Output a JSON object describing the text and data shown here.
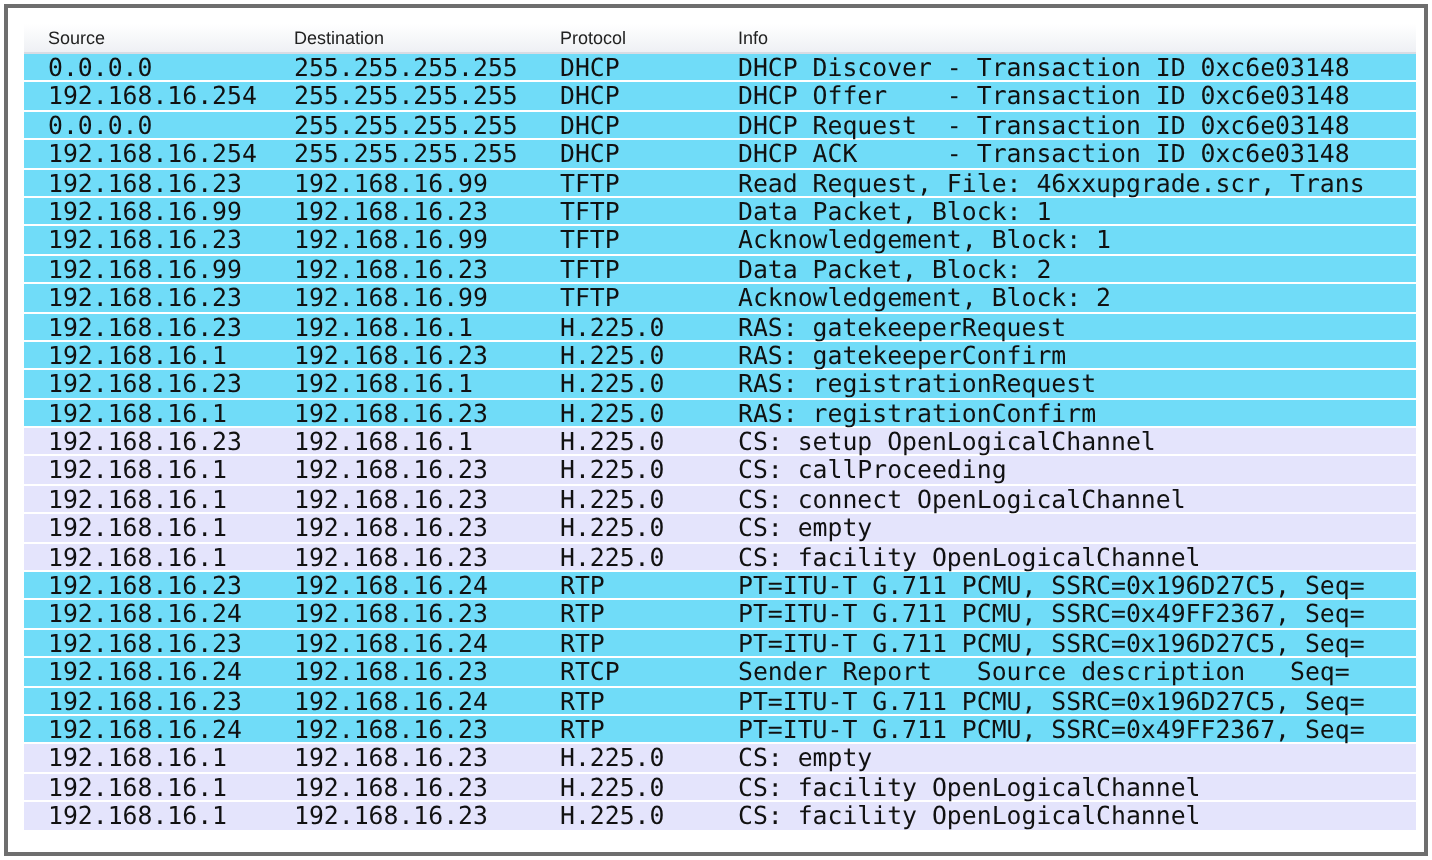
{
  "table": {
    "columns": [
      "Source",
      "Destination",
      "Protocol",
      "Info"
    ],
    "rows": [
      {
        "source": "0.0.0.0",
        "destination": "255.255.255.255",
        "protocol": "DHCP",
        "info": "DHCP Discover - Transaction ID 0xc6e03148",
        "color": "#70dcf8"
      },
      {
        "source": "192.168.16.254",
        "destination": "255.255.255.255",
        "protocol": "DHCP",
        "info": "DHCP Offer    - Transaction ID 0xc6e03148",
        "color": "#70dcf8"
      },
      {
        "source": "0.0.0.0",
        "destination": "255.255.255.255",
        "protocol": "DHCP",
        "info": "DHCP Request  - Transaction ID 0xc6e03148",
        "color": "#70dcf8"
      },
      {
        "source": "192.168.16.254",
        "destination": "255.255.255.255",
        "protocol": "DHCP",
        "info": "DHCP ACK      - Transaction ID 0xc6e03148",
        "color": "#70dcf8"
      },
      {
        "source": "192.168.16.23",
        "destination": "192.168.16.99",
        "protocol": "TFTP",
        "info": "Read Request, File: 46xxupgrade.scr, Trans",
        "color": "#70dcf8"
      },
      {
        "source": "192.168.16.99",
        "destination": "192.168.16.23",
        "protocol": "TFTP",
        "info": "Data Packet, Block: 1",
        "color": "#70dcf8"
      },
      {
        "source": "192.168.16.23",
        "destination": "192.168.16.99",
        "protocol": "TFTP",
        "info": "Acknowledgement, Block: 1",
        "color": "#70dcf8"
      },
      {
        "source": "192.168.16.99",
        "destination": "192.168.16.23",
        "protocol": "TFTP",
        "info": "Data Packet, Block: 2",
        "color": "#70dcf8"
      },
      {
        "source": "192.168.16.23",
        "destination": "192.168.16.99",
        "protocol": "TFTP",
        "info": "Acknowledgement, Block: 2",
        "color": "#70dcf8"
      },
      {
        "source": "192.168.16.23",
        "destination": "192.168.16.1",
        "protocol": "H.225.0",
        "info": "RAS: gatekeeperRequest",
        "color": "#70dcf8"
      },
      {
        "source": "192.168.16.1",
        "destination": "192.168.16.23",
        "protocol": "H.225.0",
        "info": "RAS: gatekeeperConfirm",
        "color": "#70dcf8"
      },
      {
        "source": "192.168.16.23",
        "destination": "192.168.16.1",
        "protocol": "H.225.0",
        "info": "RAS: registrationRequest",
        "color": "#70dcf8"
      },
      {
        "source": "192.168.16.1",
        "destination": "192.168.16.23",
        "protocol": "H.225.0",
        "info": "RAS: registrationConfirm",
        "color": "#70dcf8"
      },
      {
        "source": "192.168.16.23",
        "destination": "192.168.16.1",
        "protocol": "H.225.0",
        "info": "CS: setup OpenLogicalChannel",
        "color": "#e4e4fc"
      },
      {
        "source": "192.168.16.1",
        "destination": "192.168.16.23",
        "protocol": "H.225.0",
        "info": "CS: callProceeding",
        "color": "#e4e4fc"
      },
      {
        "source": "192.168.16.1",
        "destination": "192.168.16.23",
        "protocol": "H.225.0",
        "info": "CS: connect OpenLogicalChannel",
        "color": "#e4e4fc"
      },
      {
        "source": "192.168.16.1",
        "destination": "192.168.16.23",
        "protocol": "H.225.0",
        "info": "CS: empty",
        "color": "#e4e4fc"
      },
      {
        "source": "192.168.16.1",
        "destination": "192.168.16.23",
        "protocol": "H.225.0",
        "info": "CS: facility OpenLogicalChannel",
        "color": "#e4e4fc"
      },
      {
        "source": "192.168.16.23",
        "destination": "192.168.16.24",
        "protocol": "RTP",
        "info": "PT=ITU-T G.711 PCMU, SSRC=0x196D27C5, Seq=",
        "color": "#70dcf8"
      },
      {
        "source": "192.168.16.24",
        "destination": "192.168.16.23",
        "protocol": "RTP",
        "info": "PT=ITU-T G.711 PCMU, SSRC=0x49FF2367, Seq=",
        "color": "#70dcf8"
      },
      {
        "source": "192.168.16.23",
        "destination": "192.168.16.24",
        "protocol": "RTP",
        "info": "PT=ITU-T G.711 PCMU, SSRC=0x196D27C5, Seq=",
        "color": "#70dcf8"
      },
      {
        "source": "192.168.16.24",
        "destination": "192.168.16.23",
        "protocol": "RTCP",
        "info": "Sender Report   Source description   Seq=",
        "color": "#70dcf8"
      },
      {
        "source": "192.168.16.23",
        "destination": "192.168.16.24",
        "protocol": "RTP",
        "info": "PT=ITU-T G.711 PCMU, SSRC=0x196D27C5, Seq=",
        "color": "#70dcf8"
      },
      {
        "source": "192.168.16.24",
        "destination": "192.168.16.23",
        "protocol": "RTP",
        "info": "PT=ITU-T G.711 PCMU, SSRC=0x49FF2367, Seq=",
        "color": "#70dcf8"
      },
      {
        "source": "192.168.16.1",
        "destination": "192.168.16.23",
        "protocol": "H.225.0",
        "info": "CS: empty",
        "color": "#e4e4fc"
      },
      {
        "source": "192.168.16.1",
        "destination": "192.168.16.23",
        "protocol": "H.225.0",
        "info": "CS: facility OpenLogicalChannel",
        "color": "#e4e4fc"
      },
      {
        "source": "192.168.16.1",
        "destination": "192.168.16.23",
        "protocol": "H.225.0",
        "info": "CS: facility OpenLogicalChannel",
        "color": "#e4e4fc"
      }
    ]
  }
}
